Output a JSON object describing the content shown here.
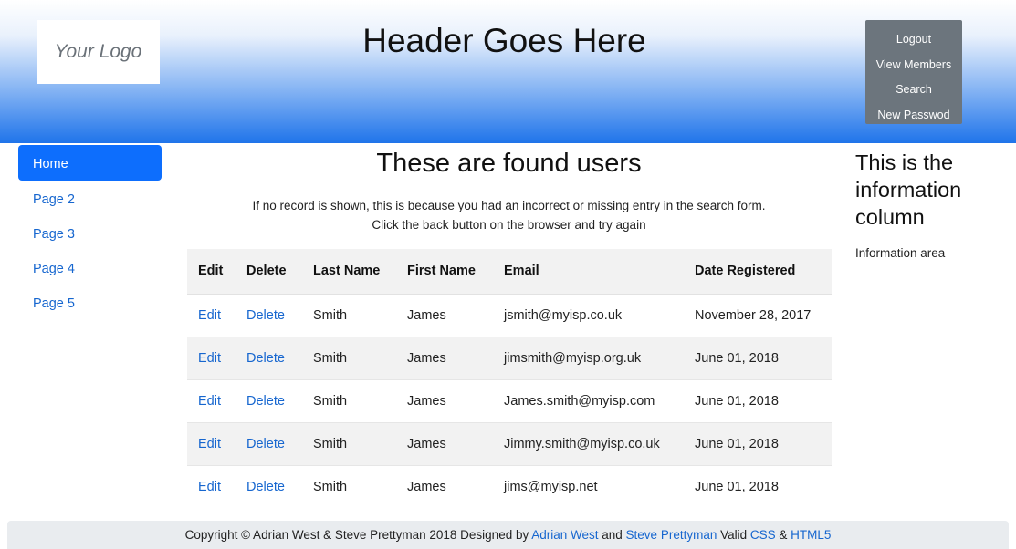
{
  "header": {
    "logo_text": "Your Logo",
    "title": "Header Goes Here",
    "nav": [
      "Logout",
      "View Members",
      "Search",
      "New Passwod"
    ]
  },
  "sidebar": {
    "items": [
      {
        "label": "Home",
        "active": true
      },
      {
        "label": "Page 2",
        "active": false
      },
      {
        "label": "Page 3",
        "active": false
      },
      {
        "label": "Page 4",
        "active": false
      },
      {
        "label": "Page 5",
        "active": false
      }
    ]
  },
  "main": {
    "title": "These are found users",
    "note_line1": "If no record is shown, this is because you had an incorrect or missing entry in the search form.",
    "note_line2": "Click the back button on the browser and try again",
    "columns": [
      "Edit",
      "Delete",
      "Last Name",
      "First Name",
      "Email",
      "Date Registered"
    ],
    "rows": [
      {
        "edit": "Edit",
        "delete": "Delete",
        "last_name": "Smith",
        "first_name": "James",
        "email": "jsmith@myisp.co.uk",
        "date": "November 28, 2017"
      },
      {
        "edit": "Edit",
        "delete": "Delete",
        "last_name": "Smith",
        "first_name": "James",
        "email": "jimsmith@myisp.org.uk",
        "date": "June 01, 2018"
      },
      {
        "edit": "Edit",
        "delete": "Delete",
        "last_name": "Smith",
        "first_name": "James",
        "email": "James.smith@myisp.com",
        "date": "June 01, 2018"
      },
      {
        "edit": "Edit",
        "delete": "Delete",
        "last_name": "Smith",
        "first_name": "James",
        "email": "Jimmy.smith@myisp.co.uk",
        "date": "June 01, 2018"
      },
      {
        "edit": "Edit",
        "delete": "Delete",
        "last_name": "Smith",
        "first_name": "James",
        "email": "jims@myisp.net",
        "date": "June 01, 2018"
      }
    ]
  },
  "info": {
    "title": "This is the information column",
    "text": "Information area"
  },
  "footer": {
    "prefix": "Copyright © Adrian West & Steve Prettyman 2018 Designed by ",
    "author1": "Adrian West",
    "and": " and ",
    "author2": "Steve Prettyman",
    "valid": " Valid ",
    "css": "CSS",
    "amp": " & ",
    "html5": "HTML5"
  },
  "colors": {
    "accent": "#0d6efd",
    "link": "#1666cf",
    "nav_box": "#6c757d",
    "footer_bg": "#e9ecef"
  }
}
